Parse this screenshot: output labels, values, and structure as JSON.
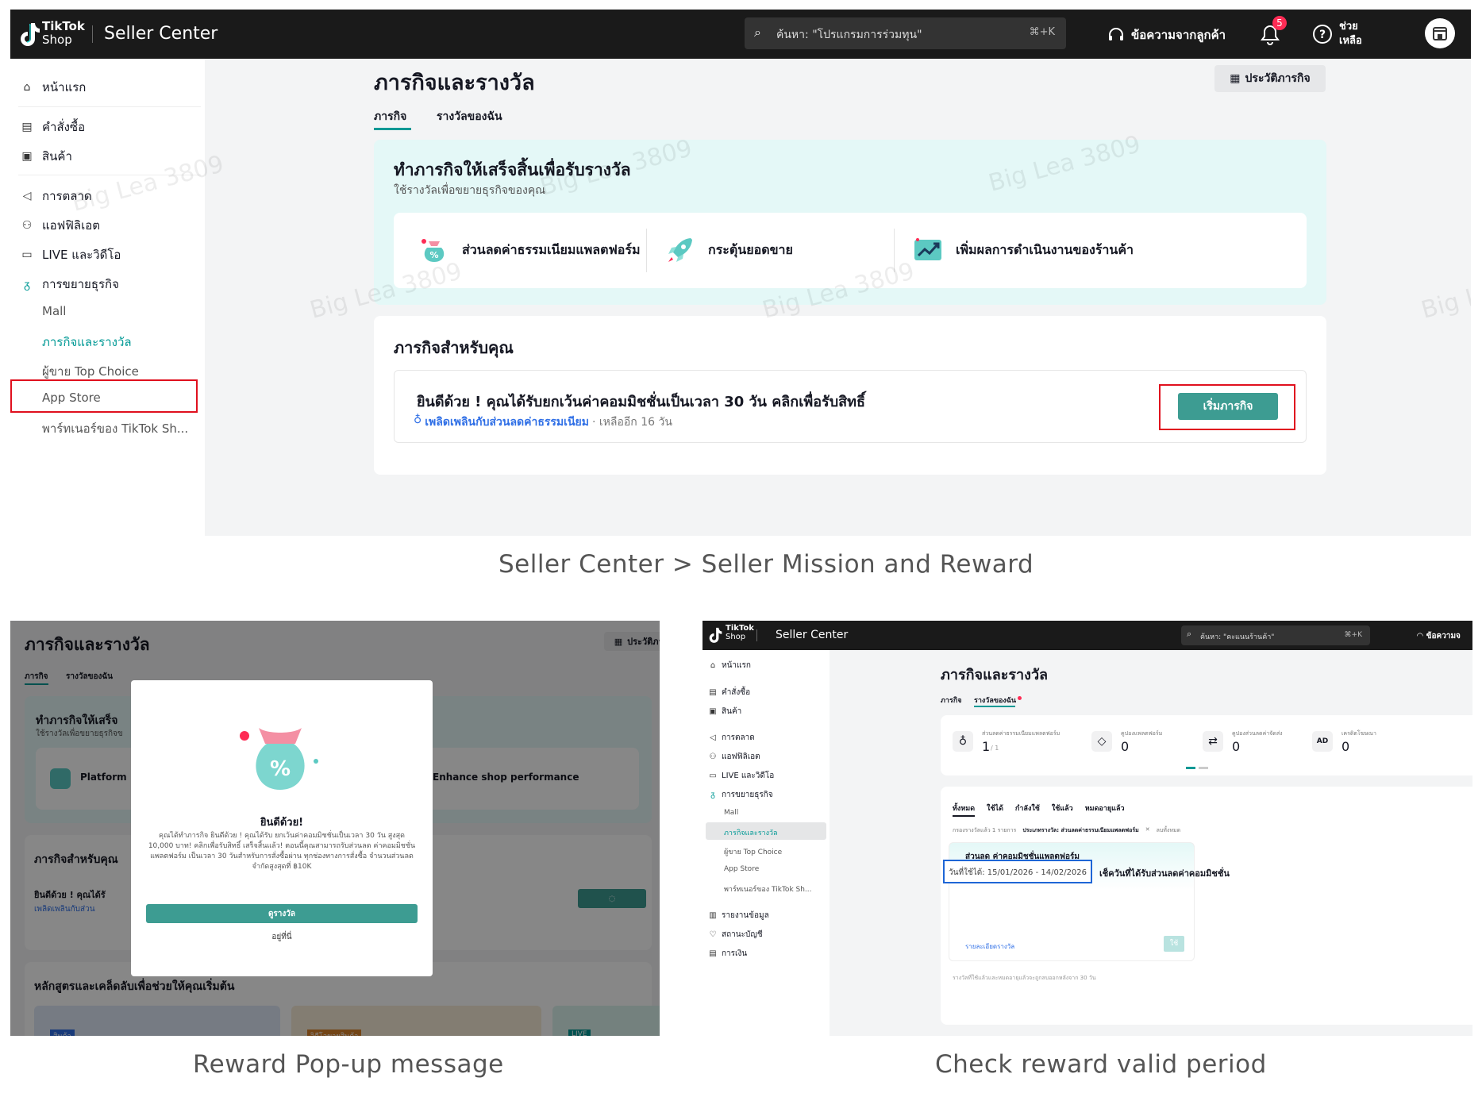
{
  "panel1": {
    "topbar": {
      "brand_line1": "TikTok",
      "brand_line2": "Shop",
      "title": "Seller Center",
      "search_placeholder": "ค้นหา: \"โปรแกรมการร่วมทุน\"",
      "search_shortcut": "⌘+K",
      "messages_label": "ข้อความจากลูกค้า",
      "notification_count": "5",
      "help_line1": "ช่วย",
      "help_line2": "เหลือ"
    },
    "sidebar": {
      "home": "หน้าแรก",
      "orders": "คำสั่งซื้อ",
      "products": "สินค้า",
      "marketing": "การตลาด",
      "affiliate": "แอฟฟิลิเอต",
      "live_video": "LIVE และวิดีโอ",
      "growth": "การขยายธุรกิจ",
      "sub_items": [
        "Mall",
        "ภารกิจและรางวัล",
        "ผู้ขาย Top Choice",
        "App Store",
        "พาร์ทเนอร์ของ TikTok Sh..."
      ],
      "active_index": 1
    },
    "main": {
      "title": "ภารกิจและรางวัล",
      "history_button": "ประวัติภารกิจ",
      "tabs": [
        "ภารกิจ",
        "รางวัลของฉัน"
      ],
      "banner_title": "ทำภารกิจให้เสร็จสิ้นเพื่อรับรางวัล",
      "banner_subtitle": "ใช้รางวัลเพื่อขยายธุรกิจของคุณ",
      "benefits": [
        "ส่วนลดค่าธรรมเนียมแพลตฟอร์ม",
        "กระตุ้นยอดขาย",
        "เพิ่มผลการดำเนินงานของร้านค้า"
      ],
      "missions_title": "ภารกิจสำหรับคุณ",
      "mission_text": "ยินดีด้วย ! คุณได้รับยกเว้นค่าคอมมิชชั่นเป็นเวลา 30 วัน คลิกเพื่อรับสิทธิ์",
      "mission_link": "เพลิดเพลินกับส่วนลดค่าธรรมเนียม",
      "mission_remaining": "· เหลืออีก 16 วัน",
      "start_button": "เริ่มภารกิจ"
    },
    "watermark": "Big Lea 3809"
  },
  "captions": {
    "panel1": "Seller Center > Seller Mission and Reward",
    "panel2": "Reward Pop-up message",
    "panel3": "Check reward valid period"
  },
  "panel2": {
    "title": "ภารกิจและรางวัล",
    "history_button": "ประวัติภารกิ",
    "tabs": [
      "ภารกิจ",
      "รางวัลของฉัน"
    ],
    "banner_title": "ทำภารกิจให้เสร็จ",
    "banner_subtitle": "ใช้รางวัลเพื่อขยายธุรกิจข",
    "benefit_left": "Platform",
    "benefit_right": "Enhance shop performance",
    "missions_title": "ภารกิจสำหรับคุณ",
    "mission_text": "ยินดีด้วย ! คุณได้รั",
    "mission_link": "เพลิดเพลินกับส่วน",
    "tips_title": "หลักสูตรและเคล็ดลับเพื่อช่วยให้คุณเริ่มต้น",
    "tags": [
      "สินค้า",
      "วิดีโอขายสินค้า",
      "LIVE"
    ],
    "modal": {
      "title": "ยินดีด้วย!",
      "body": "คุณได้ทำภารกิจ ยินดีด้วย ! คุณได้รับ ยกเว้นค่าคอมมิชชั่นเป็นเวลา 30 วัน สูงสุด 10,000 บาท! คลิกเพื่อรับสิทธิ์ เสร็จสิ้นแล้ว! ตอนนี้คุณสามารถรับส่วนลด ค่าคอมมิชชั่นแพลตฟอร์ม เป็นเวลา 30 วันสำหรับการสั่งซื้อผ่าน ทุกช่องทางการสั่งซื้อ จำนวนส่วนลดจำกัดสูงสุดที่ ฿10K",
      "primary_button": "ดูรางวัล",
      "secondary_button": "อยู่ที่นี่"
    }
  },
  "panel3": {
    "topbar": {
      "brand_line1": "TikTok",
      "brand_line2": "Shop",
      "title": "Seller Center",
      "search_placeholder": "ค้นหา: \"คะแนนร้านค้า\"",
      "search_shortcut": "⌘+K",
      "messages_label": "ข้อความจ"
    },
    "sidebar": {
      "home": "หน้าแรก",
      "orders": "คำสั่งซื้อ",
      "products": "สินค้า",
      "marketing": "การตลาด",
      "affiliate": "แอฟฟิลิเอต",
      "live_video": "LIVE และวิดีโอ",
      "growth": "การขยายธุรกิจ",
      "sub_items": [
        "Mall",
        "ภารกิจและรางวัล",
        "ผู้ขาย Top Choice",
        "App Store",
        "พาร์ทเนอร์ของ TikTok Sh..."
      ],
      "data": "รายงานข้อมูล",
      "account": "สถานะบัญชี",
      "finance": "การเงิน"
    },
    "main": {
      "title": "ภารกิจและรางวัล",
      "tabs": [
        "ภารกิจ",
        "รางวัลของฉัน"
      ],
      "stats": [
        {
          "label": "ส่วนลดค่าธรรมเนียมแพลตฟอร์ม",
          "value": "1",
          "suffix": "/ 1"
        },
        {
          "label": "คูปองแพลตฟอร์ม",
          "value": "0",
          "suffix": ""
        },
        {
          "label": "คูปองส่วนลดค่าจัดส่ง",
          "value": "0",
          "suffix": ""
        },
        {
          "label": "เครดิตโฆษณา",
          "value": "0",
          "suffix": ""
        }
      ],
      "filter_tabs": [
        "ทั้งหมด",
        "ใช้ได้",
        "กำลังใช้",
        "ใช้แล้ว",
        "หมดอายุแล้ว"
      ],
      "filter_summary": "กรองรางวัลแล้ว 1 รายการ",
      "filter_chip": "ประเภทรางวัล: ส่วนลดค่าธรรมเนียมแพลตฟอร์ม",
      "filter_clear": "ลบทั้งหมด",
      "reward_title": "ส่วนลด ค่าคอมมิชชั่นแพลตฟอร์ม",
      "valid_period": "วันที่ใช้ได้: 15/01/2026 - 14/02/2026",
      "annotation": "เช็ควันที่ได้รับส่วนลดค่าคอมมิชชั่น",
      "details_link": "รายละเอียดรางวัล",
      "use_button": "ใช้",
      "footer_note": "รางวัลที่ใช้แล้วและหมดอายุแล้วจะถูกลบออกหลังจาก 30 วัน"
    }
  }
}
